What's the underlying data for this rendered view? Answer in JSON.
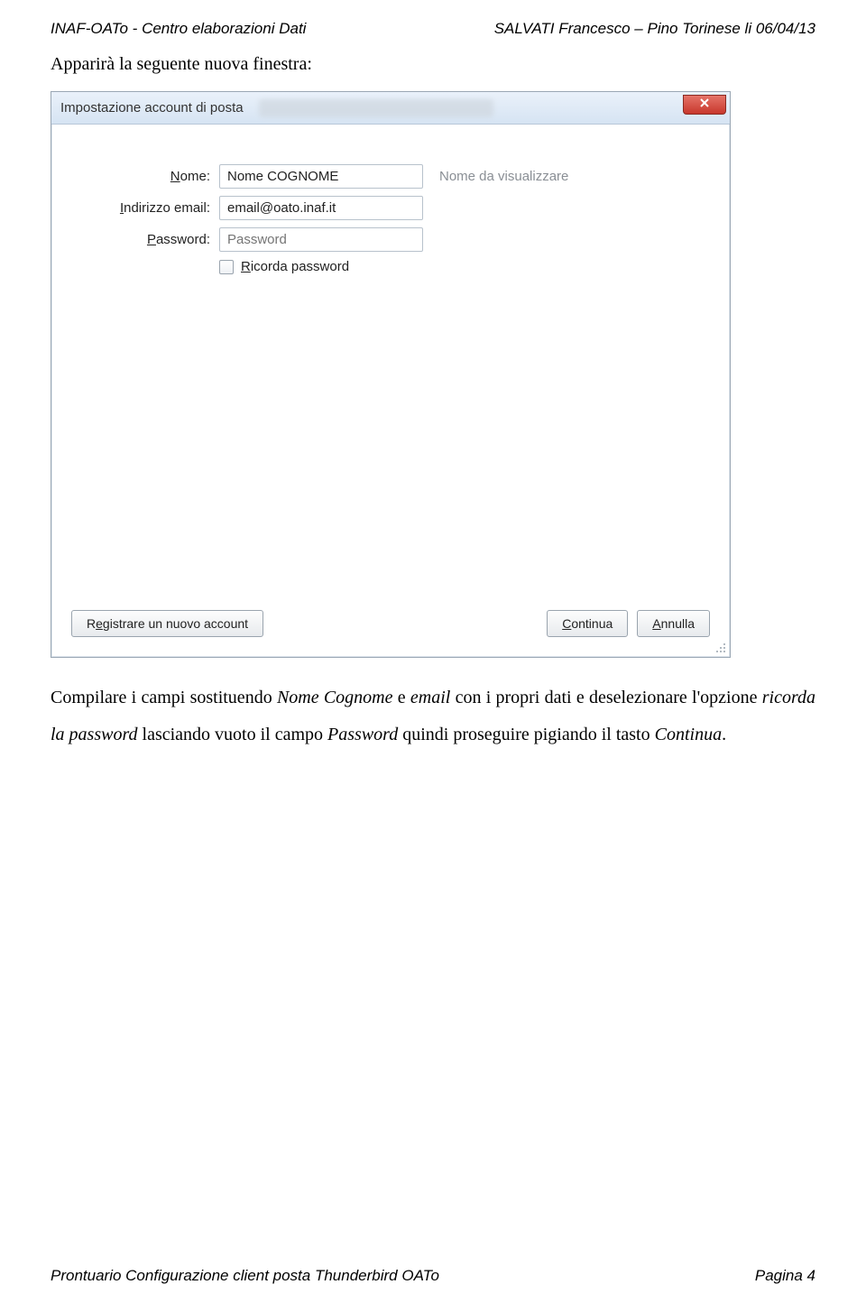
{
  "header": {
    "left": "INAF-OATo - Centro elaborazioni Dati",
    "right": "SALVATI Francesco – Pino Torinese li 06/04/13"
  },
  "intro": "Apparirà la seguente nuova finestra:",
  "dialog": {
    "title": "Impostazione account di posta",
    "fields": {
      "name_label_pre": "",
      "name_label_ul": "N",
      "name_label_post": "ome:",
      "name_value": "Nome COGNOME",
      "name_hint": "Nome da visualizzare",
      "email_label_pre": "",
      "email_label_ul": "I",
      "email_label_post": "ndirizzo email:",
      "email_value": "email@oato.inaf.it",
      "pwd_label_ul": "P",
      "pwd_label_post": "assword:",
      "pwd_placeholder": "Password",
      "remember_ul": "R",
      "remember_post": "icorda password"
    },
    "buttons": {
      "register_pre": "R",
      "register_ul": "e",
      "register_post": "gistrare un nuovo account",
      "continue_ul": "C",
      "continue_post": "ontinua",
      "cancel_ul": "A",
      "cancel_post": "nnulla"
    }
  },
  "body": {
    "p1_a": "Compilare i campi sostituendo ",
    "p1_b": "Nome Cognome",
    "p1_c": " e ",
    "p1_d": "email",
    "p1_e": " con i propri dati e deselezionare l'opzione ",
    "p1_f": "ricorda la password",
    "p1_g": " lasciando vuoto il campo ",
    "p1_h": "Password",
    "p1_i": " quindi proseguire pigiando il tasto ",
    "p1_j": "Continua",
    "p1_k": "."
  },
  "footer": {
    "left": "Prontuario Configurazione client posta Thunderbird OATo",
    "right": "Pagina 4"
  }
}
